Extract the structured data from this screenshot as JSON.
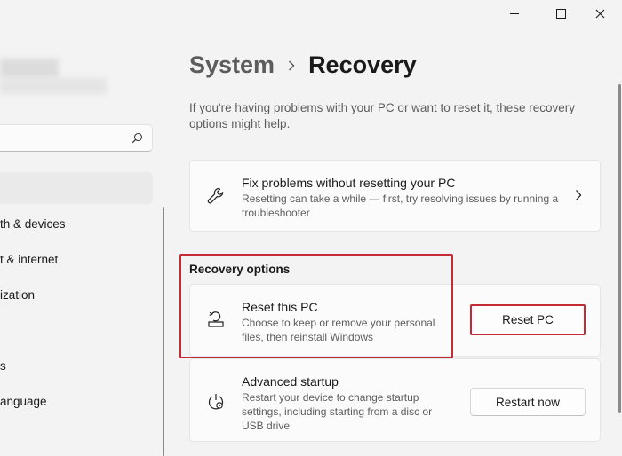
{
  "window": {
    "minimize_icon": "minimize-icon",
    "maximize_icon": "maximize-icon",
    "close_icon": "close-icon"
  },
  "sidebar": {
    "search": {
      "value": "",
      "placeholder": "",
      "icon": "search-icon"
    },
    "items": [
      {
        "label": ""
      },
      {
        "label": "th & devices"
      },
      {
        "label": "t & internet"
      },
      {
        "label": "ization"
      },
      {
        "label": ""
      },
      {
        "label": "s"
      },
      {
        "label": "anguage"
      }
    ]
  },
  "breadcrumb": {
    "parent": "System",
    "separator_icon": "chevron-right-icon",
    "current": "Recovery"
  },
  "intro": "If you're having problems with your PC or want to reset it, these recovery options might help.",
  "fix_card": {
    "icon": "wrench-icon",
    "title": "Fix problems without resetting your PC",
    "description": "Resetting can take a while — first, try resolving issues by running a troubleshooter"
  },
  "recovery_options": {
    "title": "Recovery options",
    "reset": {
      "icon": "reset-pc-icon",
      "title": "Reset this PC",
      "description": "Choose to keep or remove your personal files, then reinstall Windows",
      "button": "Reset PC"
    },
    "advanced": {
      "icon": "advanced-startup-icon",
      "title": "Advanced startup",
      "description": "Restart your device to change startup settings, including starting from a disc or USB drive",
      "button": "Restart now"
    }
  },
  "colors": {
    "highlight": "#c62a35",
    "background": "#f3f3f3",
    "card": "#fbfbfb"
  }
}
